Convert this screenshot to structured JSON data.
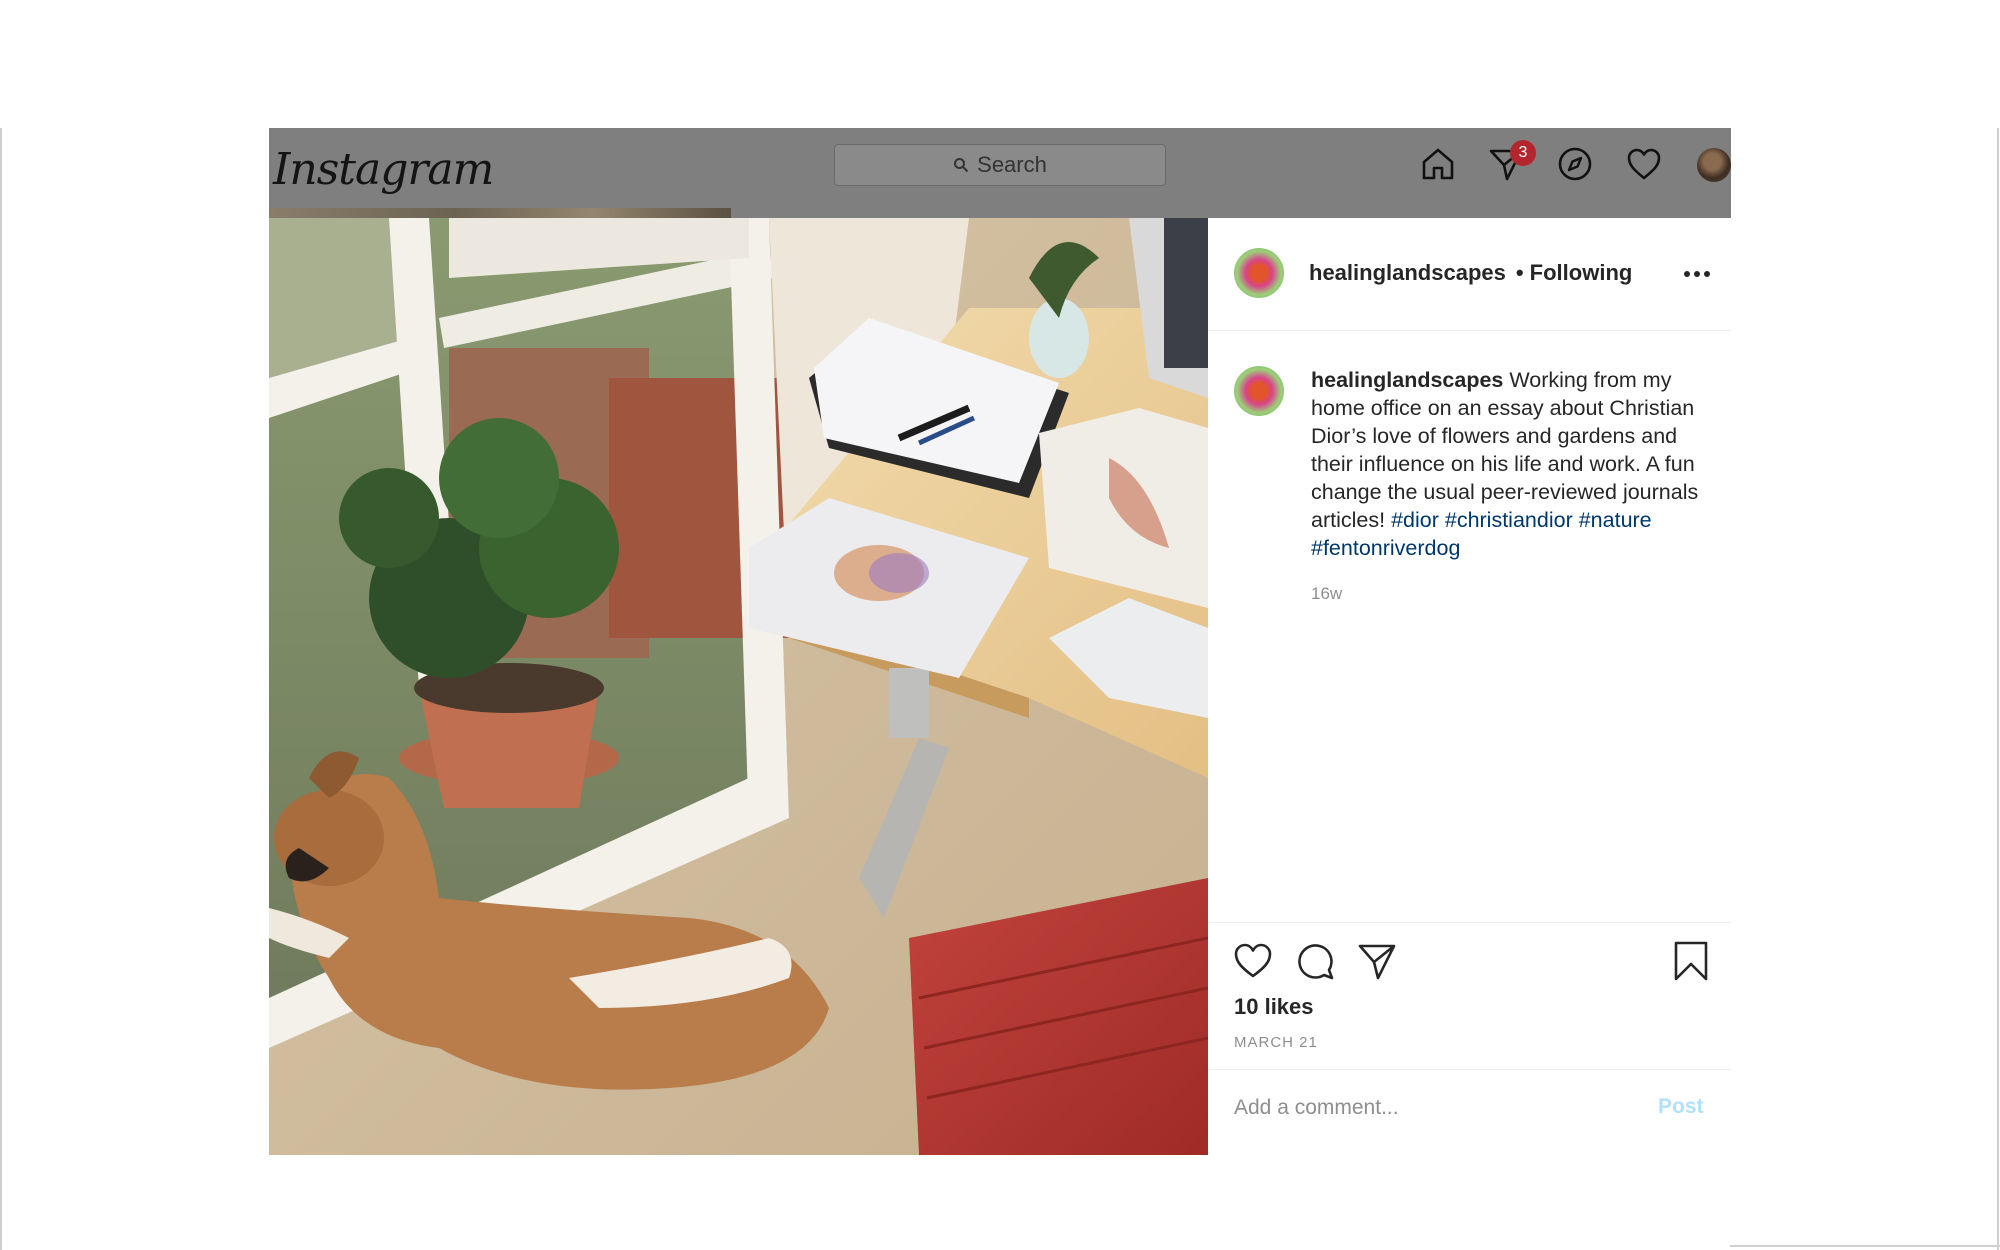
{
  "app": {
    "logo_text": "Instagram"
  },
  "header": {
    "search": {
      "placeholder": "Search"
    },
    "nav": [
      {
        "name": "home-icon"
      },
      {
        "name": "direct-icon",
        "badge": "3"
      },
      {
        "name": "explore-icon"
      },
      {
        "name": "activity-icon"
      },
      {
        "name": "profile-avatar"
      }
    ]
  },
  "post": {
    "author": "healinglandscapes",
    "follow_status": "• Following",
    "more_icon": "more-options-icon",
    "caption": {
      "author": "healinglandscapes",
      "text": "Working from my home office on an essay about Christian Dior’s love of flowers and gardens and their influence on his life and work. A fun change the usual peer-reviewed journals articles!",
      "hashtags": [
        "#dior",
        "#christiandior",
        "#nature",
        "#fentonriverdog"
      ]
    },
    "age": "16w",
    "likes": "10 likes",
    "date": "MARCH 21",
    "actions": [
      "like-icon",
      "comment-icon",
      "share-icon",
      "save-icon"
    ],
    "comment": {
      "placeholder": "Add a comment...",
      "post_label": "Post"
    }
  },
  "colors": {
    "dim_overlay": "#7f7f7f",
    "badge": "#b3262e",
    "hashtag": "#00376b",
    "post_button_disabled": "#b2dffc",
    "muted_text": "#8e8e8e"
  }
}
